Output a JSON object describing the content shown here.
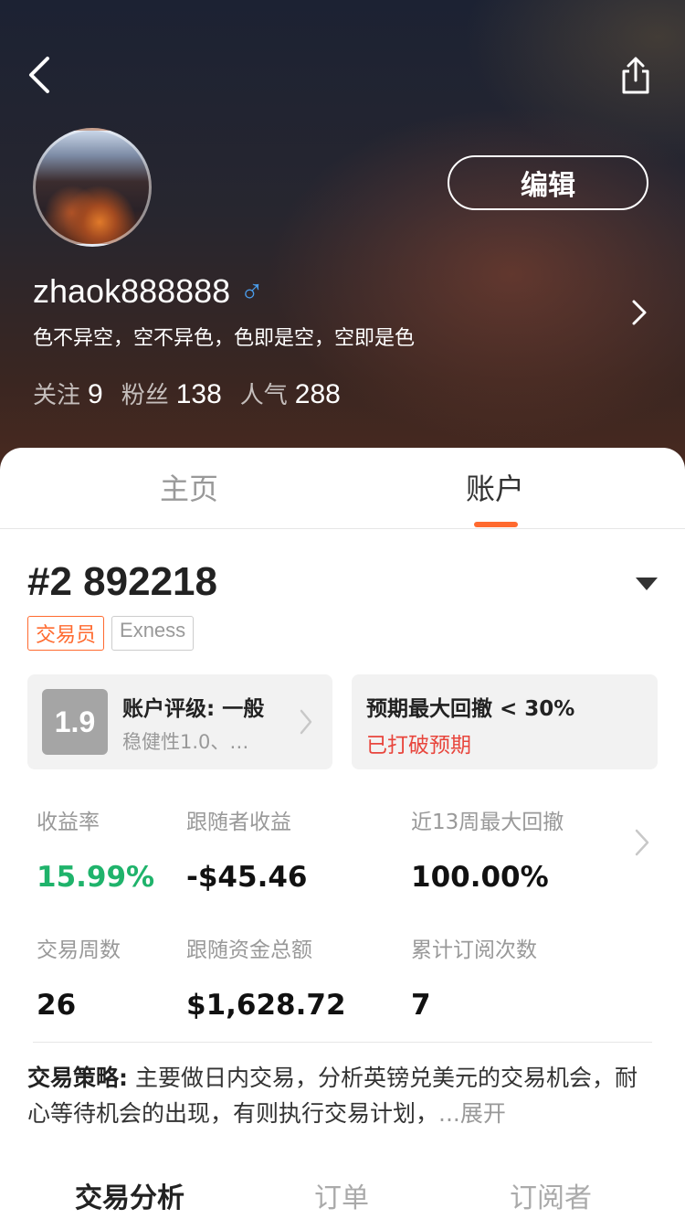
{
  "header": {
    "back_icon": "chevron-left-icon",
    "share_icon": "share-icon",
    "edit_label": "编辑",
    "username": "zhaok888888",
    "gender_symbol": "♂",
    "bio": "色不异空，空不异色，色即是空，空即是色",
    "stats": [
      {
        "label": "关注",
        "value": "9"
      },
      {
        "label": "粉丝",
        "value": "138"
      },
      {
        "label": "人气",
        "value": "288"
      }
    ]
  },
  "tabs": [
    {
      "label": "主页",
      "active": false
    },
    {
      "label": "账户",
      "active": true
    }
  ],
  "account": {
    "number": "#2 892218",
    "badges": [
      "交易员",
      "Exness"
    ],
    "score": "1.9",
    "rating_title": "账户评级: 一般",
    "rating_sub": "稳健性1.0、…",
    "drawdown_title": "预期最大回撤 < 30%",
    "drawdown_status": "已打破预期"
  },
  "metrics": [
    {
      "label": "收益率",
      "value": "15.99%"
    },
    {
      "label": "跟随者收益",
      "value": "-$45.46"
    },
    {
      "label": "近13周最大回撤",
      "value": "100.00%"
    },
    {
      "label": "交易周数",
      "value": "26"
    },
    {
      "label": "跟随资金总额",
      "value": "$1,628.72"
    },
    {
      "label": "累计订阅次数",
      "value": "7"
    }
  ],
  "strategy": {
    "label": "交易策略:",
    "text": " 主要做日内交易，分析英镑兑美元的交易机会，耐心等待机会的出现，有则执行交易计划，",
    "expand": "...展开"
  },
  "bottom_tabs": [
    {
      "label": "交易分析",
      "active": true
    },
    {
      "label": "订单",
      "active": false
    },
    {
      "label": "订阅者",
      "active": false
    }
  ],
  "colors": {
    "accent": "#ff6a2f",
    "positive": "#1fb36b",
    "warning": "#e8453c",
    "gender": "#4a9be8"
  }
}
